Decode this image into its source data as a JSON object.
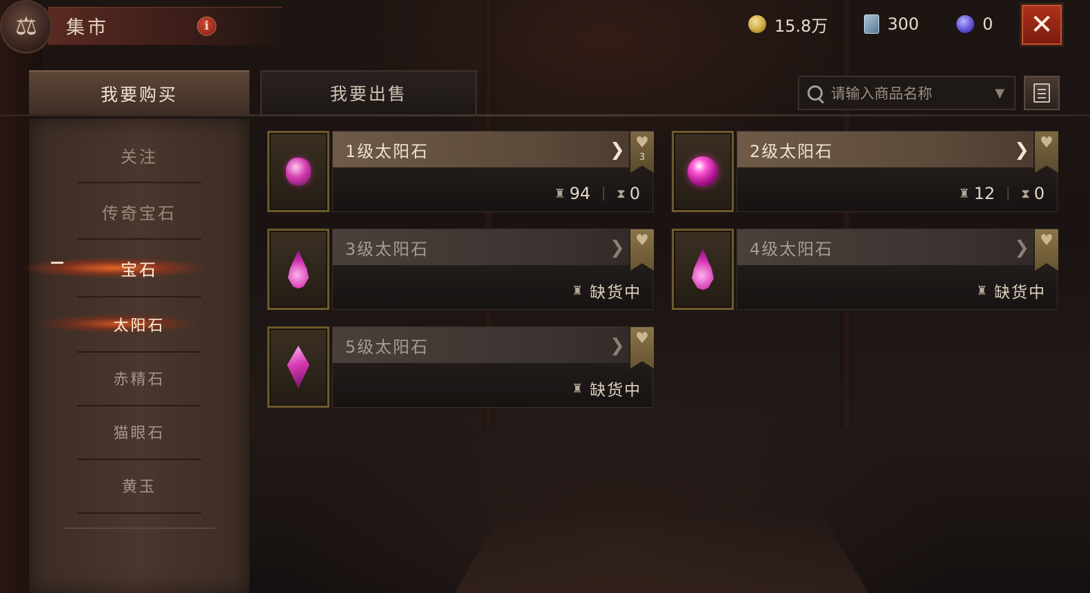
{
  "header": {
    "title": "集市",
    "emblem_icon": "scales-icon",
    "info_icon": "info-icon"
  },
  "currencies": [
    {
      "icon": "gold-coin-icon",
      "value": "15.8万"
    },
    {
      "icon": "scroll-icon",
      "value": "300"
    },
    {
      "icon": "purple-orb-icon",
      "value": "0"
    }
  ],
  "tabs": {
    "buy_label": "我要购买",
    "sell_label": "我要出售"
  },
  "search": {
    "placeholder": "请输入商品名称"
  },
  "sidebar": {
    "items": [
      {
        "label": "关注"
      },
      {
        "label": "传奇宝石"
      },
      {
        "label": "宝石"
      },
      {
        "label": "太阳石"
      },
      {
        "label": "赤精石"
      },
      {
        "label": "猫眼石"
      },
      {
        "label": "黄玉"
      }
    ]
  },
  "items": [
    {
      "name": "1级太阳石",
      "favorites": "3",
      "listings": "94",
      "sold": "0",
      "status": "available",
      "gem_icon": "faceted-round-gem-icon"
    },
    {
      "name": "2级太阳石",
      "favorites": "",
      "listings": "12",
      "sold": "0",
      "status": "available",
      "gem_icon": "sphere-gem-icon"
    },
    {
      "name": "3级太阳石",
      "status_text": "缺货中",
      "status": "out_of_stock",
      "gem_icon": "teardrop-gem-icon"
    },
    {
      "name": "4级太阳石",
      "status_text": "缺货中",
      "status": "out_of_stock",
      "gem_icon": "faceted-drop-gem-icon"
    },
    {
      "name": "5级太阳石",
      "status_text": "缺货中",
      "status": "out_of_stock",
      "gem_icon": "marquise-gem-icon"
    }
  ],
  "colors": {
    "gem_magenta": "#d43bb0",
    "close_red": "#b0321c",
    "active_glow": "#ff6e28"
  }
}
